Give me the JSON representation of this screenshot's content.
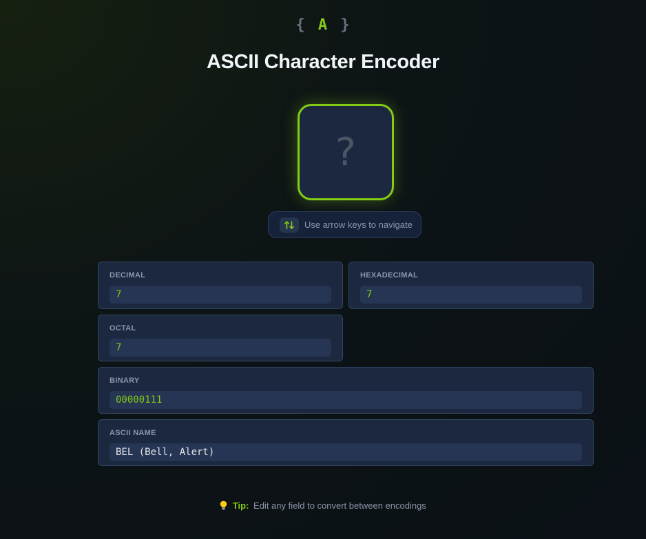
{
  "logo": {
    "open_brace": "{",
    "letter": "A",
    "close_brace": "}"
  },
  "title": "ASCII Character Encoder",
  "character_display": {
    "glyph": "?"
  },
  "nav_hint": {
    "icon": "up-down-arrows-icon",
    "text": "Use arrow keys to navigate"
  },
  "fields": {
    "decimal": {
      "label": "DECIMAL",
      "value": "7"
    },
    "hexadecimal": {
      "label": "HEXADECIMAL",
      "value": "7"
    },
    "octal": {
      "label": "OCTAL",
      "value": "7"
    },
    "binary": {
      "label": "BINARY",
      "value": "00000111"
    },
    "ascii_name": {
      "label": "ASCII NAME",
      "value": "BEL (Bell, Alert)"
    }
  },
  "tip": {
    "icon": "lightbulb-icon",
    "label": "Tip:",
    "text": "Edit any field to convert between encodings"
  },
  "colors": {
    "accent": "#84cc16",
    "card_bg": "#1b2840",
    "field_bg": "#253553",
    "muted_text": "#8b96a8"
  }
}
